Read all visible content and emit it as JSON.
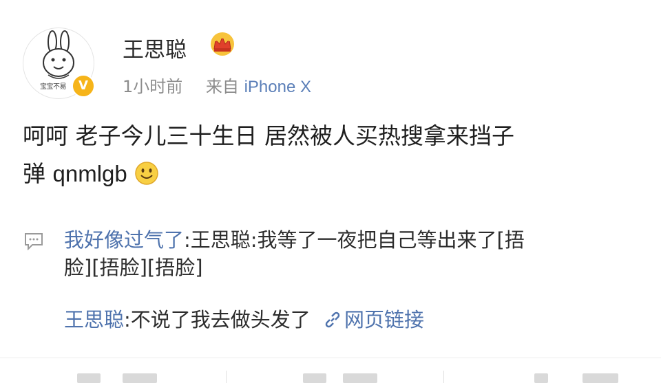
{
  "header": {
    "username": "王思聪",
    "time": "1小时前",
    "source_prefix": "来自",
    "device": "iPhone X",
    "avatar_caption": "宝宝不易",
    "verified_mark": "V"
  },
  "post": {
    "line1": "呵呵 老子今儿三十生日 居然被人买热搜拿来挡子",
    "line2_cjk": "弹 ",
    "line2_latin": "qnmlgb"
  },
  "comments": [
    {
      "name": "我好像过气了",
      "text_line1": ":王思聪:我等了一夜把自己等出来了[捂",
      "text_line2": "脸][捂脸][捂脸]"
    },
    {
      "name": "王思聪",
      "text": ":不说了我去做头发了 ",
      "link_label": "网页链接"
    }
  ],
  "icons": {
    "crown": "crown-icon",
    "smile": "smile-emoji-icon",
    "comment": "comment-icon",
    "link": "link-icon",
    "verified": "verified-icon"
  },
  "colors": {
    "link_blue": "#4f73ad",
    "meta_gray": "#8c8c8c",
    "verified_gold": "#f6b41a"
  }
}
